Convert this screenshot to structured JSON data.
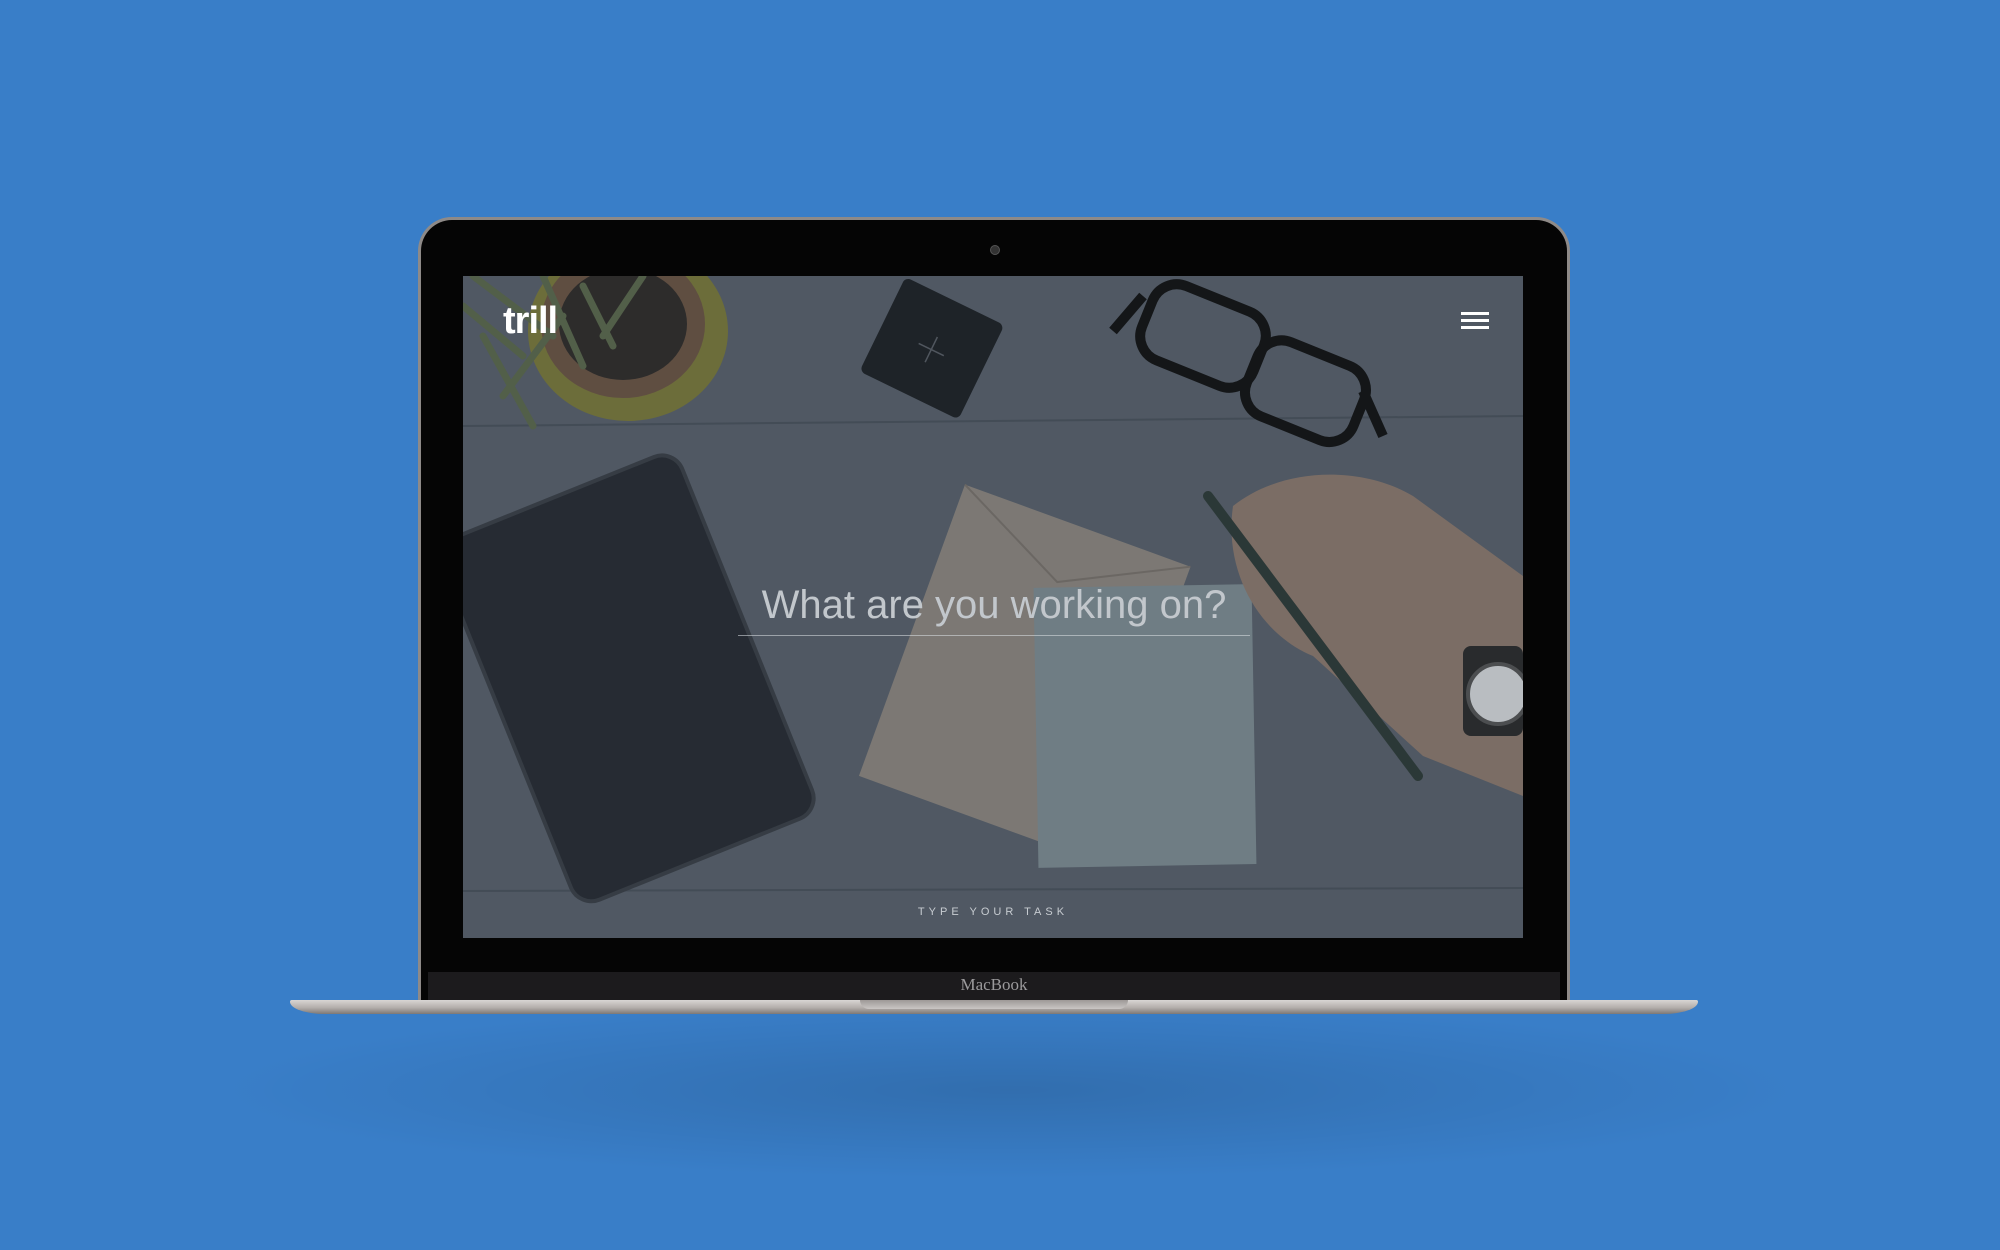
{
  "app": {
    "logo": "trill",
    "menu_icon": "hamburger-menu-icon"
  },
  "task": {
    "placeholder": "What are you working on?",
    "hint": "TYPE YOUR TASK"
  },
  "device": {
    "label": "MacBook"
  },
  "colors": {
    "background": "#397ec8",
    "screen_overlay": "#4f5762",
    "text": "#ffffff"
  }
}
